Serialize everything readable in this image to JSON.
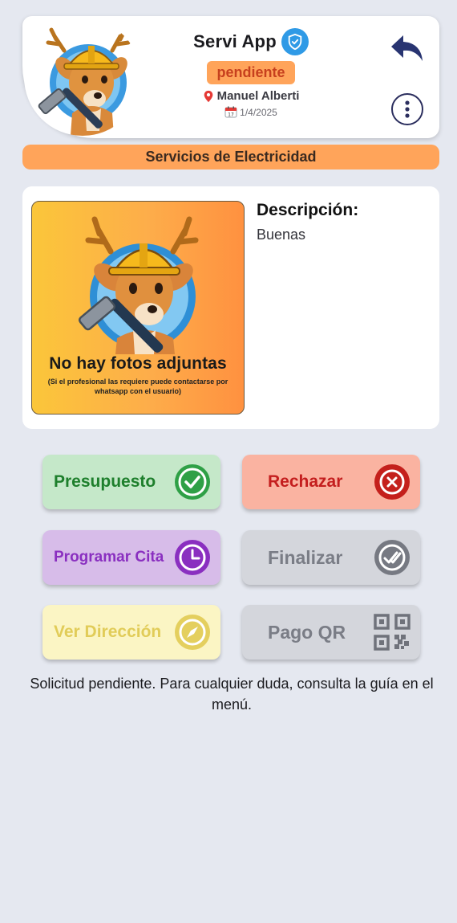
{
  "header": {
    "app_title": "Servi App",
    "status": "pendiente",
    "user_name": "Manuel Alberti",
    "date": "1/4/2025",
    "logo_icon": "deer-mascot-hardhat-hammer",
    "verified_icon": "shield-check-icon",
    "back_icon": "reply-arrow-icon",
    "menu_icon": "vertical-dots-icon"
  },
  "category": "Servicios de Electricidad",
  "content": {
    "photo_title": "No hay fotos adjuntas",
    "photo_subtitle": "(Si el profesional las requiere puede contactarse por whatsapp con el usuario)",
    "description_label": "Descripción:",
    "description_text": "Buenas"
  },
  "actions": {
    "presupuesto": "Presupuesto",
    "rechazar": "Rechazar",
    "programar_cita": "Programar Cita",
    "finalizar": "Finalizar",
    "ver_direccion": "Ver Dirección",
    "pago_qr": "Pago QR"
  },
  "footer_note": "Solicitud pendiente. Para cualquier duda, consulta la guía en el menú.",
  "colors": {
    "accent_orange": "#ffa45a",
    "status_text": "#c7401e",
    "presupuesto_bg": "#c5e8c9",
    "rechazar_bg": "#fab3a1",
    "cita_bg": "#d7bce9",
    "disabled_bg": "#d4d6dc",
    "direccion_bg": "#fbf5c4"
  }
}
